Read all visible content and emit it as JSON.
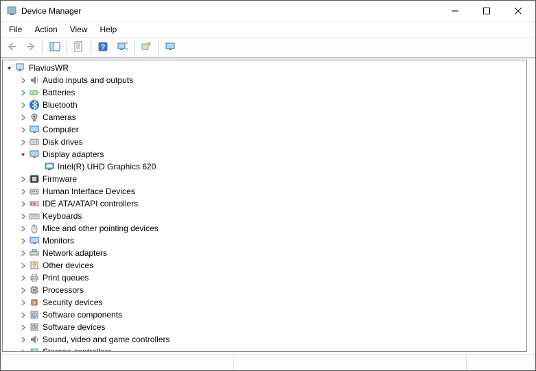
{
  "window": {
    "title": "Device Manager"
  },
  "menu": {
    "items": [
      "File",
      "Action",
      "View",
      "Help"
    ]
  },
  "toolbar": {
    "back": "Back",
    "forward": "Forward",
    "show_hide_tree": "Show/Hide Console Tree",
    "properties": "Properties",
    "help": "Help",
    "scan": "Scan for hardware changes",
    "add_legacy": "Add legacy hardware",
    "devices_by_connection": "View"
  },
  "tree": {
    "root": {
      "label": "FlaviusWR"
    },
    "nodes": [
      {
        "label": "Audio inputs and outputs",
        "icon": "audio",
        "expandable": true
      },
      {
        "label": "Batteries",
        "icon": "battery",
        "expandable": true
      },
      {
        "label": "Bluetooth",
        "icon": "bluetooth",
        "expandable": true
      },
      {
        "label": "Cameras",
        "icon": "camera",
        "expandable": true
      },
      {
        "label": "Computer",
        "icon": "computer",
        "expandable": true
      },
      {
        "label": "Disk drives",
        "icon": "disk",
        "expandable": true
      },
      {
        "label": "Display adapters",
        "icon": "display",
        "expandable": true,
        "expanded": true,
        "children": [
          {
            "label": "Intel(R) UHD Graphics 620",
            "icon": "display-device"
          }
        ]
      },
      {
        "label": "Firmware",
        "icon": "firmware",
        "expandable": true
      },
      {
        "label": "Human Interface Devices",
        "icon": "hid",
        "expandable": true
      },
      {
        "label": "IDE ATA/ATAPI controllers",
        "icon": "ide",
        "expandable": true
      },
      {
        "label": "Keyboards",
        "icon": "keyboard",
        "expandable": true
      },
      {
        "label": "Mice and other pointing devices",
        "icon": "mouse",
        "expandable": true
      },
      {
        "label": "Monitors",
        "icon": "monitor",
        "expandable": true
      },
      {
        "label": "Network adapters",
        "icon": "network",
        "expandable": true
      },
      {
        "label": "Other devices",
        "icon": "other",
        "expandable": true
      },
      {
        "label": "Print queues",
        "icon": "print",
        "expandable": true
      },
      {
        "label": "Processors",
        "icon": "processor",
        "expandable": true
      },
      {
        "label": "Security devices",
        "icon": "security",
        "expandable": true
      },
      {
        "label": "Software components",
        "icon": "swcomp",
        "expandable": true
      },
      {
        "label": "Software devices",
        "icon": "swdev",
        "expandable": true
      },
      {
        "label": "Sound, video and game controllers",
        "icon": "sound",
        "expandable": true
      },
      {
        "label": "Storage controllers",
        "icon": "storage",
        "expandable": true
      }
    ]
  }
}
